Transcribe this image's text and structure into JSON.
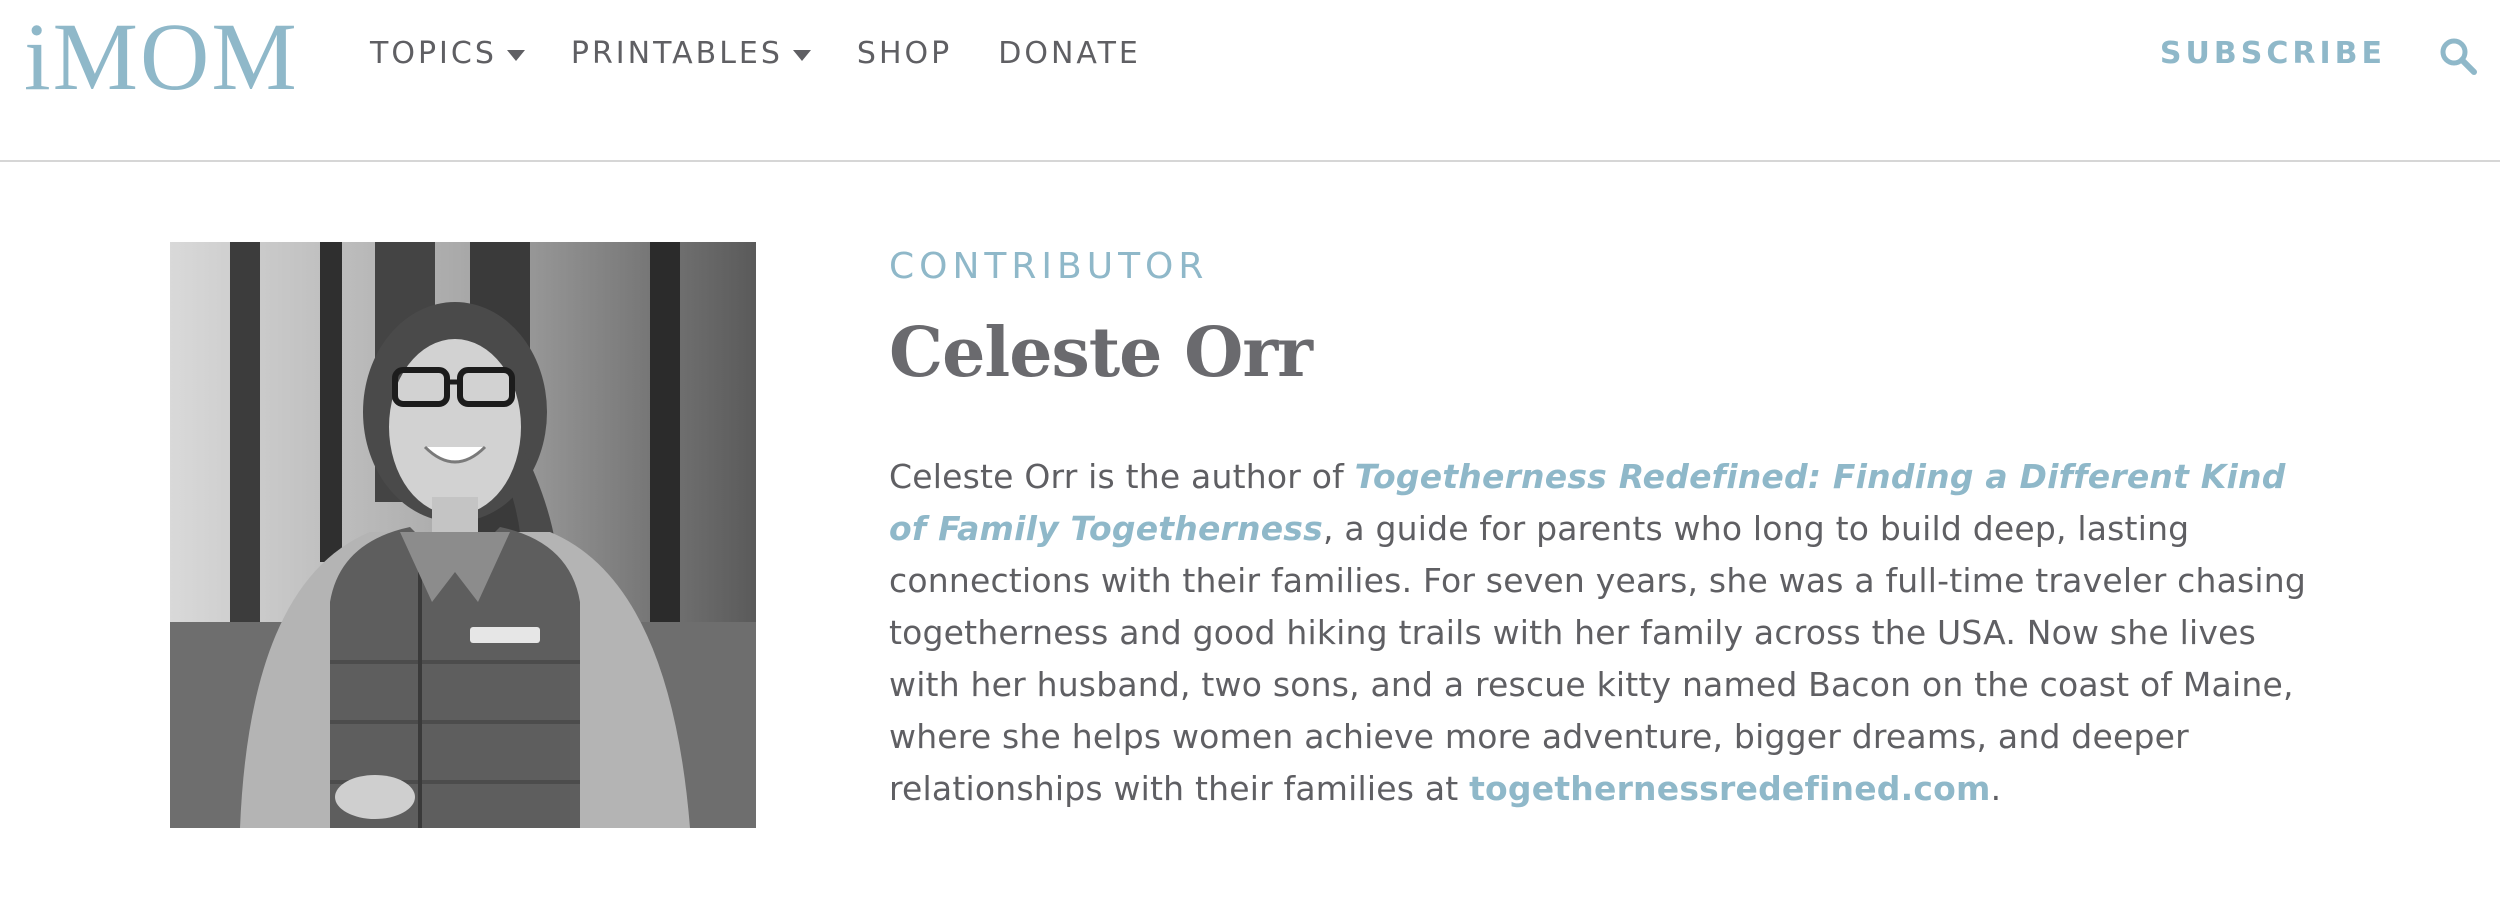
{
  "header": {
    "logo": "iMOM",
    "nav": [
      {
        "label": "TOPICS",
        "has_dropdown": true
      },
      {
        "label": "PRINTABLES",
        "has_dropdown": true
      },
      {
        "label": "SHOP",
        "has_dropdown": false
      },
      {
        "label": "DONATE",
        "has_dropdown": false
      }
    ],
    "subscribe_label": "SUBSCRIBE",
    "search_icon": "search-icon"
  },
  "contributor": {
    "role": "CONTRIBUTOR",
    "name": "Celeste Orr",
    "bio_intro": "Celeste Orr is the author of ",
    "book_title": "Togetherness Redefined: Finding a Different Kind of Family Togetherness",
    "bio_middle": ", a guide for parents who long to build deep, lasting connections with their families. For seven years, she was a full-time traveler chasing togetherness and good hiking trails with her family across the USA. Now she lives with her husband, two sons, and a rescue kitty named Bacon on the coast of Maine, where she helps women achieve more adventure, bigger dreams, and deeper relationships with their families at ",
    "website": "togethernessredefined.com",
    "bio_end": "."
  },
  "colors": {
    "accent": "#8fb8c9",
    "text": "#5f5f63",
    "divider": "#d6d6d6"
  }
}
